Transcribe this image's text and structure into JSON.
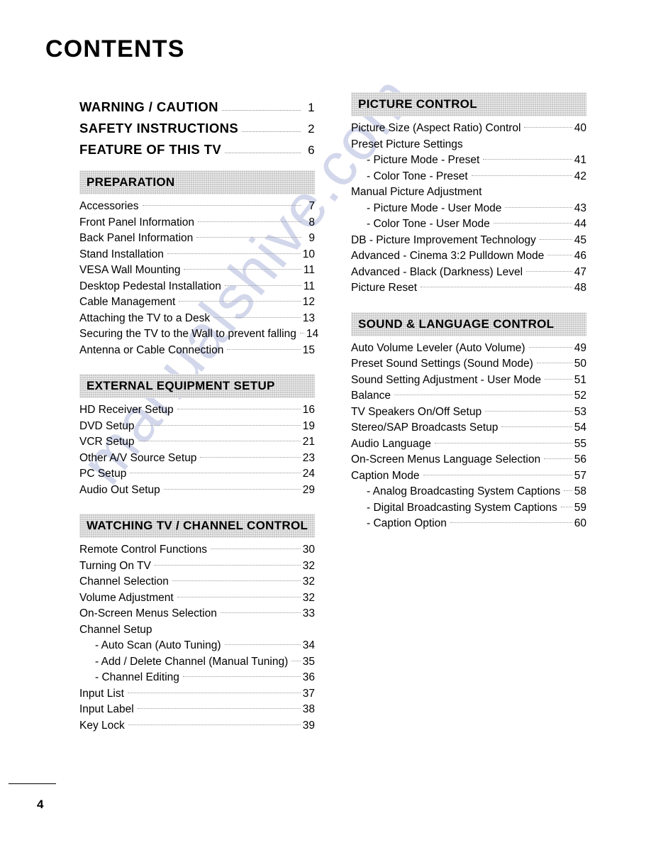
{
  "document": {
    "title": "CONTENTS",
    "page_number": "4",
    "watermark": "manualshive.com"
  },
  "left_column": {
    "top_entries": [
      {
        "label": "WARNING / CAUTION",
        "page": "1"
      },
      {
        "label": "SAFETY INSTRUCTIONS",
        "page": "2"
      },
      {
        "label": "FEATURE OF THIS TV",
        "page": "6"
      }
    ],
    "sections": [
      {
        "heading": "PREPARATION",
        "entries": [
          {
            "label": "Accessories",
            "page": "7",
            "sub": false
          },
          {
            "label": "Front Panel Information",
            "page": "8",
            "sub": false
          },
          {
            "label": "Back Panel Information",
            "page": "9",
            "sub": false
          },
          {
            "label": "Stand Installation",
            "page": "10",
            "sub": false
          },
          {
            "label": "VESA Wall Mounting",
            "page": "11",
            "sub": false
          },
          {
            "label": "Desktop Pedestal Installation",
            "page": "11",
            "sub": false
          },
          {
            "label": "Cable Management",
            "page": "12",
            "sub": false
          },
          {
            "label": "Attaching the TV to a Desk",
            "page": "13",
            "sub": false
          },
          {
            "label": "Securing the TV to the Wall to prevent falling",
            "page": "14",
            "sub": false
          },
          {
            "label": "Antenna or Cable Connection",
            "page": "15",
            "sub": false
          }
        ]
      },
      {
        "heading": "EXTERNAL EQUIPMENT SETUP",
        "entries": [
          {
            "label": "HD Receiver Setup",
            "page": "16",
            "sub": false
          },
          {
            "label": "DVD Setup",
            "page": "19",
            "sub": false
          },
          {
            "label": "VCR Setup",
            "page": "21",
            "sub": false
          },
          {
            "label": "Other A/V Source Setup",
            "page": "23",
            "sub": false
          },
          {
            "label": "PC Setup",
            "page": "24",
            "sub": false
          },
          {
            "label": "Audio Out Setup",
            "page": "29",
            "sub": false
          }
        ]
      },
      {
        "heading": "WATCHING TV / CHANNEL CONTROL",
        "entries": [
          {
            "label": "Remote Control Functions",
            "page": "30",
            "sub": false
          },
          {
            "label": "Turning On TV",
            "page": "32",
            "sub": false
          },
          {
            "label": "Channel Selection",
            "page": "32",
            "sub": false
          },
          {
            "label": "Volume Adjustment",
            "page": "32",
            "sub": false
          },
          {
            "label": "On-Screen Menus Selection",
            "page": "33",
            "sub": false
          },
          {
            "label": "Channel Setup",
            "page": "",
            "sub": false
          },
          {
            "label": "- Auto Scan (Auto Tuning)",
            "page": "34",
            "sub": true
          },
          {
            "label": "- Add / Delete Channel (Manual Tuning)",
            "page": "35",
            "sub": true
          },
          {
            "label": "- Channel Editing",
            "page": "36",
            "sub": true
          },
          {
            "label": "Input List",
            "page": "37",
            "sub": false
          },
          {
            "label": "Input Label",
            "page": "38",
            "sub": false
          },
          {
            "label": "Key Lock",
            "page": "39",
            "sub": false
          }
        ]
      }
    ]
  },
  "right_column": {
    "sections": [
      {
        "heading": "PICTURE CONTROL",
        "entries": [
          {
            "label": "Picture Size (Aspect Ratio) Control",
            "page": "40",
            "sub": false
          },
          {
            "label": "Preset Picture Settings",
            "page": "",
            "sub": false
          },
          {
            "label": "- Picture Mode - Preset",
            "page": "41",
            "sub": true
          },
          {
            "label": "- Color Tone - Preset",
            "page": "42",
            "sub": true
          },
          {
            "label": "Manual Picture Adjustment",
            "page": "",
            "sub": false
          },
          {
            "label": "- Picture Mode - User Mode",
            "page": "43",
            "sub": true
          },
          {
            "label": "- Color Tone - User Mode",
            "page": "44",
            "sub": true
          },
          {
            "label": "DB - Picture Improvement Technology",
            "page": "45",
            "sub": false
          },
          {
            "label": "Advanced - Cinema 3:2 Pulldown Mode",
            "page": "46",
            "sub": false
          },
          {
            "label": "Advanced - Black (Darkness) Level",
            "page": "47",
            "sub": false
          },
          {
            "label": "Picture Reset",
            "page": "48",
            "sub": false
          }
        ]
      },
      {
        "heading": "SOUND & LANGUAGE CONTROL",
        "entries": [
          {
            "label": "Auto Volume Leveler (Auto Volume)",
            "page": "49",
            "sub": false
          },
          {
            "label": "Preset Sound Settings (Sound Mode)",
            "page": "50",
            "sub": false
          },
          {
            "label": "Sound Setting Adjustment - User Mode",
            "page": "51",
            "sub": false
          },
          {
            "label": "Balance",
            "page": "52",
            "sub": false
          },
          {
            "label": "TV Speakers On/Off Setup",
            "page": "53",
            "sub": false
          },
          {
            "label": "Stereo/SAP Broadcasts Setup",
            "page": "54",
            "sub": false
          },
          {
            "label": "Audio Language",
            "page": "55",
            "sub": false
          },
          {
            "label": "On-Screen Menus Language Selection",
            "page": "56",
            "sub": false
          },
          {
            "label": "Caption Mode",
            "page": "57",
            "sub": false
          },
          {
            "label": "- Analog Broadcasting System Captions",
            "page": "58",
            "sub": true
          },
          {
            "label": "- Digital Broadcasting System Captions",
            "page": "59",
            "sub": true
          },
          {
            "label": "- Caption Option",
            "page": "60",
            "sub": true
          }
        ]
      }
    ]
  }
}
